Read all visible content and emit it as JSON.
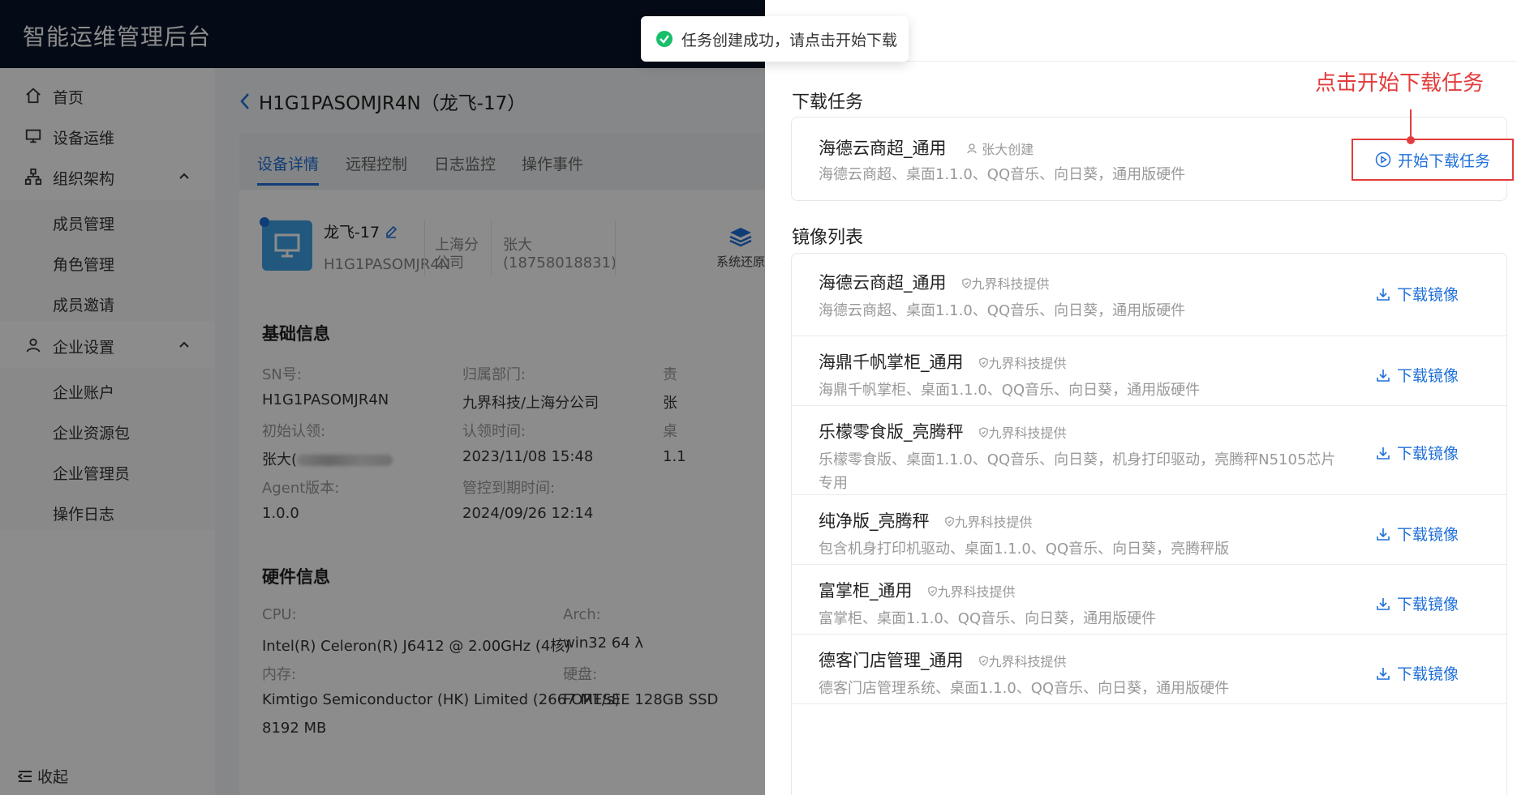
{
  "app": {
    "title": "智能运维管理后台"
  },
  "sidebar": {
    "items": [
      {
        "label": "首页"
      },
      {
        "label": "设备运维"
      },
      {
        "label": "组织架构"
      },
      {
        "label": "企业设置"
      }
    ],
    "org_children": [
      "成员管理",
      "角色管理",
      "成员邀请"
    ],
    "enterprise_children": [
      "企业账户",
      "企业资源包",
      "企业管理员",
      "操作日志"
    ],
    "collapse_label": "收起"
  },
  "main": {
    "title": "H1G1PASOMJR4N（龙飞-17）",
    "tabs": [
      "设备详情",
      "远程控制",
      "日志监控",
      "操作事件"
    ],
    "device": {
      "name": "龙飞-17",
      "sn": "H1G1PASOMJR4N",
      "dept_line1": "上海分",
      "dept_line2": "公司",
      "owner_line1": "张大",
      "owner_line2": "(18758018831)",
      "restore_label": "系统还原"
    },
    "basic": {
      "title": "基础信息",
      "sn_label": "SN号:",
      "sn_value": "H1G1PASOMJR4N",
      "dept_label": "归属部门:",
      "dept_value": "九界科技/上海分公司",
      "col3_label": "责",
      "col3_value": "张",
      "claimer_label": "初始认领:",
      "claimer_value": "张大(",
      "claim_time_label": "认领时间:",
      "claim_time_value": "2023/11/08 15:48",
      "col3b_label": "桌",
      "col3b_value": "1.1",
      "agent_label": "Agent版本:",
      "agent_value": "1.0.0",
      "expire_label": "管控到期时间:",
      "expire_value": "2024/09/26 12:14"
    },
    "hardware": {
      "title": "硬件信息",
      "cpu_label": "CPU:",
      "cpu_value": "Intel(R) Celeron(R) J6412 @ 2.00GHz (4核)",
      "arch_label": "Arch:",
      "arch_value": "win32 64 λ",
      "mem_label": "内存:",
      "mem_value1": "Kimtigo Semiconductor (HK) Limited (2667 MT/s)",
      "mem_value2": "8192 MB",
      "disk_label": "硬盘:",
      "disk_value": "FORESEE 128GB SSD"
    }
  },
  "toast": {
    "message": "任务创建成功，请点击开始下载",
    "color": "#19be6b"
  },
  "drawer": {
    "task_section": "下载任务",
    "task": {
      "name": "海德云商超_通用",
      "creator": "张大创建",
      "desc": "海德云商超、桌面1.1.0、QQ音乐、向日葵，通用版硬件",
      "button": "开始下载任务"
    },
    "annotation": "点击开始下载任务",
    "image_section": "镜像列表",
    "images": [
      {
        "name": "海德云商超_通用",
        "provider": "九界科技提供",
        "desc1": "海德云商超、桌面1.1.0、QQ音乐、向日葵，通用版硬件",
        "desc2": "",
        "action": "下载镜像"
      },
      {
        "name": "海鼎千帆掌柜_通用",
        "provider": "九界科技提供",
        "desc1": "海鼎千帆掌柜、桌面1.1.0、QQ音乐、向日葵，通用版硬件",
        "desc2": "",
        "action": "下载镜像"
      },
      {
        "name": "乐檬零食版_亮腾秤",
        "provider": "九界科技提供",
        "desc1": "乐檬零食版、桌面1.1.0、QQ音乐、向日葵，机身打印驱动，亮腾秤N5105芯片",
        "desc2": "专用",
        "action": "下载镜像"
      },
      {
        "name": "纯净版_亮腾秤",
        "provider": "九界科技提供",
        "desc1": "包含机身打印机驱动、桌面1.1.0、QQ音乐、向日葵，亮腾秤版",
        "desc2": "",
        "action": "下载镜像"
      },
      {
        "name": "富掌柜_通用",
        "provider": "九界科技提供",
        "desc1": "富掌柜、桌面1.1.0、QQ音乐、向日葵，通用版硬件",
        "desc2": "",
        "action": "下载镜像"
      },
      {
        "name": "德客门店管理_通用",
        "provider": "九界科技提供",
        "desc1": "德客门店管理系统、桌面1.1.0、QQ音乐、向日葵，通用版硬件",
        "desc2": "",
        "action": "下载镜像"
      }
    ]
  },
  "colors": {
    "primary": "#1e6fd9",
    "annotation": "#e23c3c",
    "header_bg": "#081428"
  }
}
